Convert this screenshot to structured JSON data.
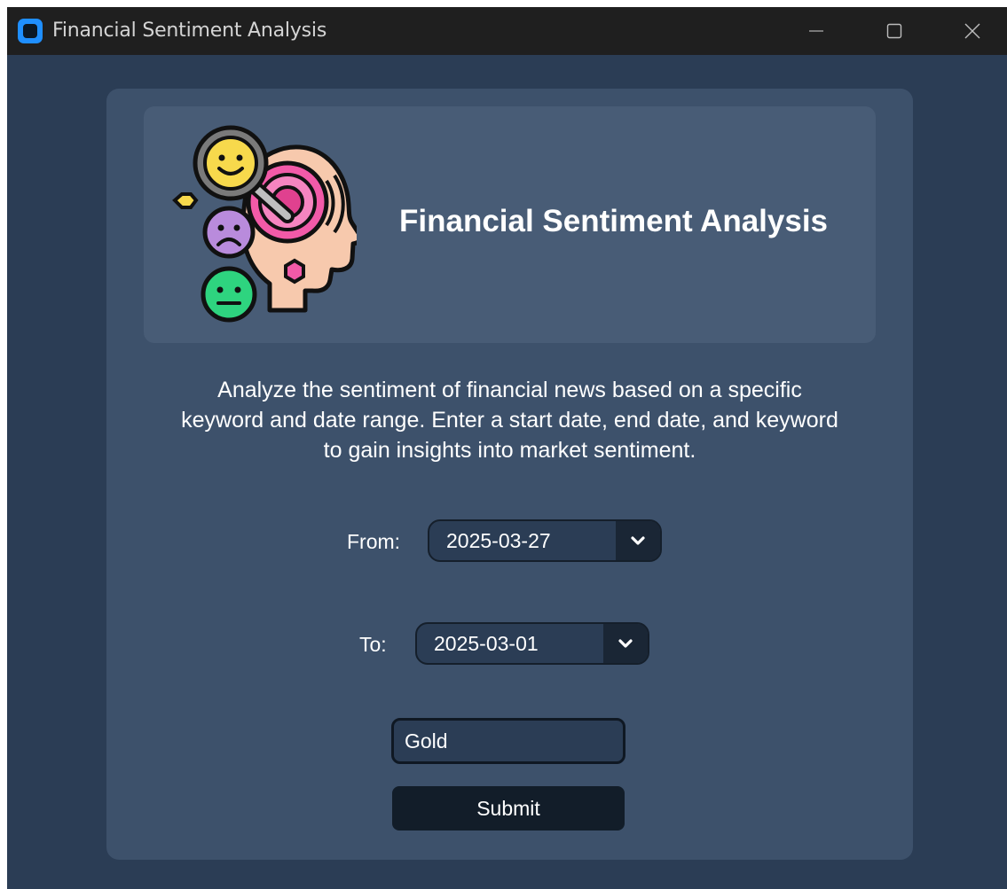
{
  "window": {
    "title": "Financial Sentiment Analysis",
    "icon": "app-icon",
    "controls": [
      "minimize-icon",
      "maximize-icon",
      "close-icon"
    ]
  },
  "header": {
    "logo": "head-sentiment-emoji-logo",
    "title": "Financial Sentiment Analysis"
  },
  "description": "Analyze the sentiment of financial news based on a specific keyword and date range. Enter a start date, end date, and keyword to gain insights into market sentiment.",
  "form": {
    "from_label": "From:",
    "from_value": "2025-03-27",
    "to_label": "To:",
    "to_value": "2025-03-01",
    "keyword_value": "Gold",
    "submit_label": "Submit"
  },
  "colors": {
    "window_bg": "#2b3d55",
    "card_bg": "#3d516b",
    "header_bg": "#485c76",
    "titlebar_bg": "#1f1f1f",
    "button_bg": "#121d29",
    "accent": "#1e90ff"
  }
}
